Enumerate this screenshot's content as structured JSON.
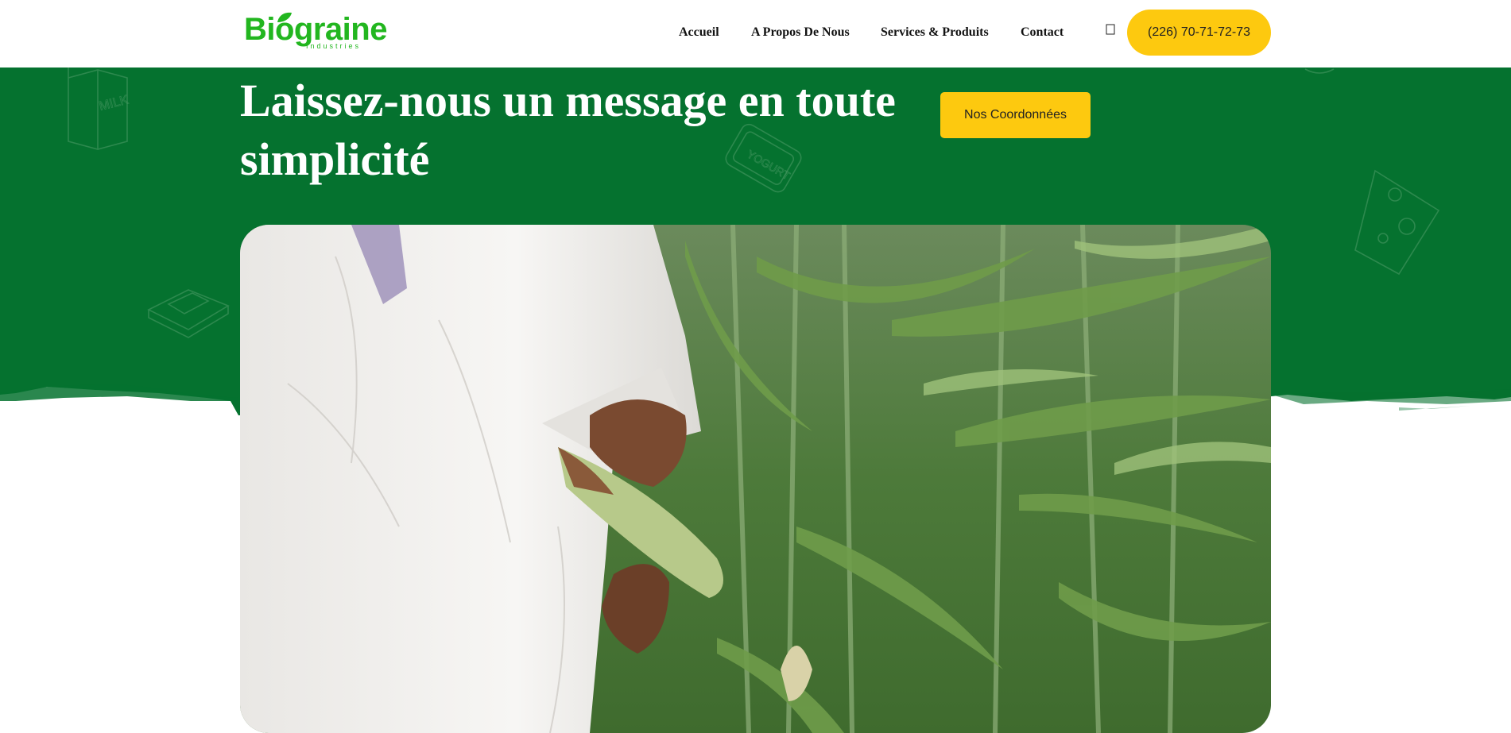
{
  "brand": {
    "logo_text": "Biograine",
    "logo_subtext": "Industries",
    "logo_color": "#22b61f"
  },
  "nav": {
    "items": [
      {
        "label": "Accueil"
      },
      {
        "label": "A Propos De Nous"
      },
      {
        "label": "Services & Produits"
      },
      {
        "label": "Contact"
      }
    ],
    "search_icon": "search-icon",
    "phone_label": "(226) 70-71-72-73"
  },
  "hero": {
    "title": "Laissez-nous un message en toute simplicité",
    "button_label": "Nos Coordonnées",
    "background_color": "#05722f",
    "button_color": "#fdc90f"
  },
  "doodles": [
    {
      "label": "MILK"
    },
    {
      "label": "YOGURT"
    }
  ],
  "image": {
    "subject": "farmer-picking-corn-photo"
  }
}
